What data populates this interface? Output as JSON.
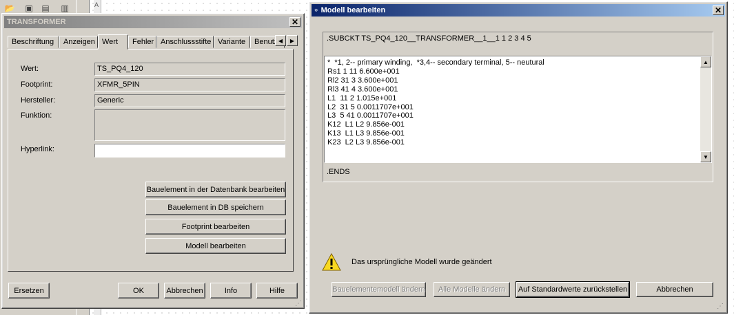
{
  "background": {
    "ruler_marker": "A"
  },
  "transformer_dialog": {
    "title": "TRANSFORMER",
    "tabs": [
      "Beschriftung",
      "Anzeigen",
      "Wert",
      "Fehler",
      "Anschlussstifte",
      "Variante",
      "Benutz"
    ],
    "active_tab": "Wert",
    "fields": {
      "wert_label": "Wert:",
      "wert_value": "TS_PQ4_120",
      "footprint_label": "Footprint:",
      "footprint_value": "XFMR_5PIN",
      "hersteller_label": "Hersteller:",
      "hersteller_value": "Generic",
      "funktion_label": "Funktion:",
      "funktion_value": "",
      "hyperlink_label": "Hyperlink:",
      "hyperlink_value": ""
    },
    "action_buttons": {
      "edit_in_db": "Bauelement in der Datenbank bearbeiten",
      "save_in_db": "Bauelement in DB speichern",
      "edit_footprint": "Footprint bearbeiten",
      "edit_model": "Modell bearbeiten"
    },
    "bottom_buttons": {
      "replace": "Ersetzen",
      "ok": "OK",
      "cancel": "Abbrechen",
      "info": "Info",
      "help": "Hilfe"
    }
  },
  "modell_dialog": {
    "title": "Modell bearbeiten",
    "subckt_header": ".SUBCKT TS_PQ4_120__TRANSFORMER__1__1 1 2 3 4 5",
    "model_lines": [
      "*  *1, 2-- primary winding,  *3,4-- secondary terminal, 5-- neutural",
      "Rs1 1 11 6.600e+001",
      "Rl2 31 3 3.600e+001",
      "Rl3 41 4 3.600e+001",
      "L1  11 2 1.015e+001",
      "L2  31 5 0.0011707e+001",
      "L3  5 41 0.0011707e+001",
      "K12  L1 L2 9.856e-001",
      "K13  L1 L3 9.856e-001",
      "K23  L2 L3 9.856e-001"
    ],
    "ends": ".ENDS",
    "warning_text": "Das ursprüngliche Modell wurde geändert",
    "buttons": {
      "change_component_model": "Bauelementemodell ändern",
      "change_all_models": "Alle Modelle ändern",
      "reset_defaults": "Auf Standardwerte zurückstellen",
      "cancel": "Abbrechen"
    }
  }
}
